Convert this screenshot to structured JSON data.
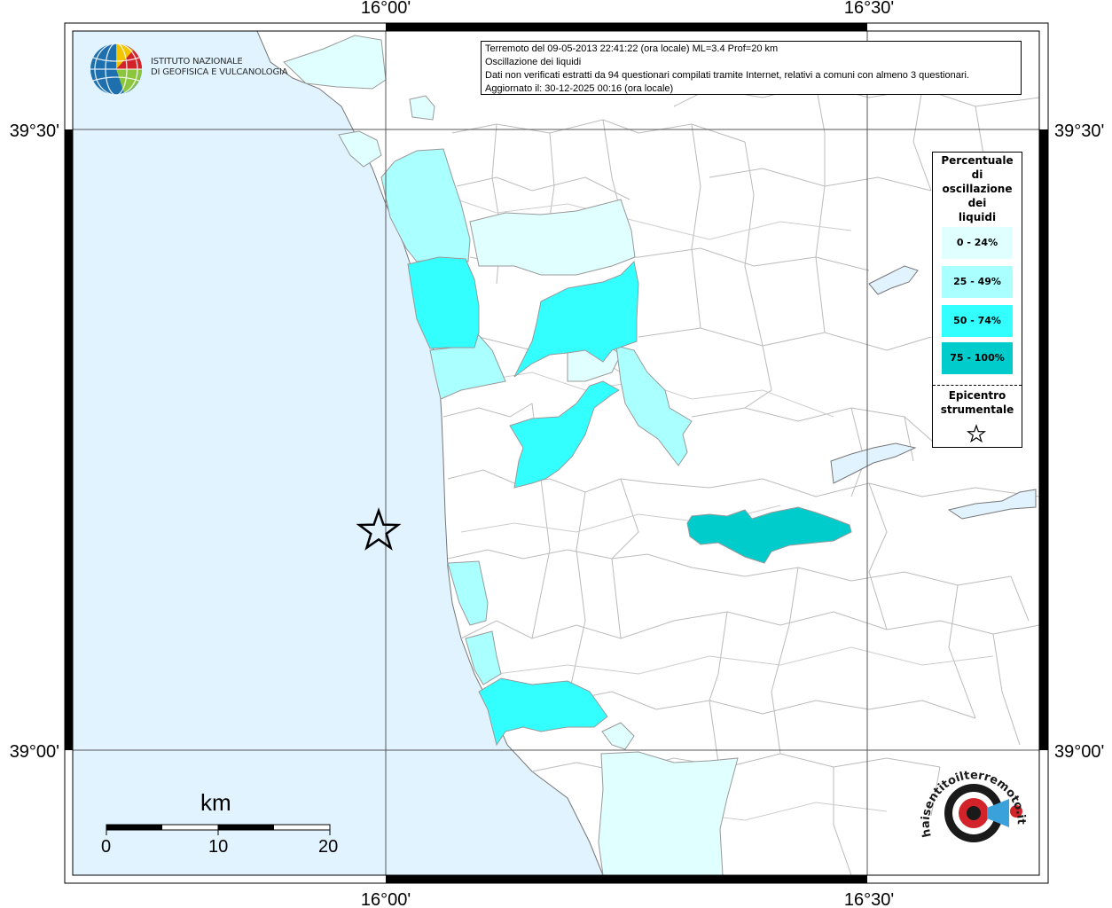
{
  "info": {
    "line1": "Terremoto del 09-05-2013 22:41:22 (ora locale) ML=3.4 Prof=20 km",
    "line2": "Oscillazione dei liquidi",
    "line3": "Dati non verificati estratti da 94 questionari compilati tramite Internet, relativi a comuni con almeno 3 questionari.",
    "line4": "Aggiornato il: 30-12-2025 00:16 (ora locale)"
  },
  "coords": {
    "lon_left": "16°00'",
    "lon_right": "16°30'",
    "lat_top": "39°30'",
    "lat_bottom": "39°00'"
  },
  "legend": {
    "title": "Percentuale di oscillazione dei liquidi",
    "classes": [
      {
        "label": "0 - 24%",
        "color": "#e0ffff"
      },
      {
        "label": "25 - 49%",
        "color": "#aaffff"
      },
      {
        "label": "50 - 74%",
        "color": "#33ffff"
      },
      {
        "label": "75 - 100%",
        "color": "#00cccc"
      }
    ],
    "epicenter_label": "Epicentro strumentale"
  },
  "scale": {
    "unit": "km",
    "labels": [
      "0",
      "10",
      "20"
    ]
  },
  "logos": {
    "ingv_line1": "ISTITUTO NAZIONALE",
    "ingv_line2": "DI GEOFISICA E VULCANOLOGIA",
    "hst_text": "haisentitoilterremoto.it"
  },
  "colors": {
    "sea": "#e0f3ff",
    "land": "#ffffff",
    "border": "#bbbbbb",
    "river": "#c8c8c8"
  }
}
